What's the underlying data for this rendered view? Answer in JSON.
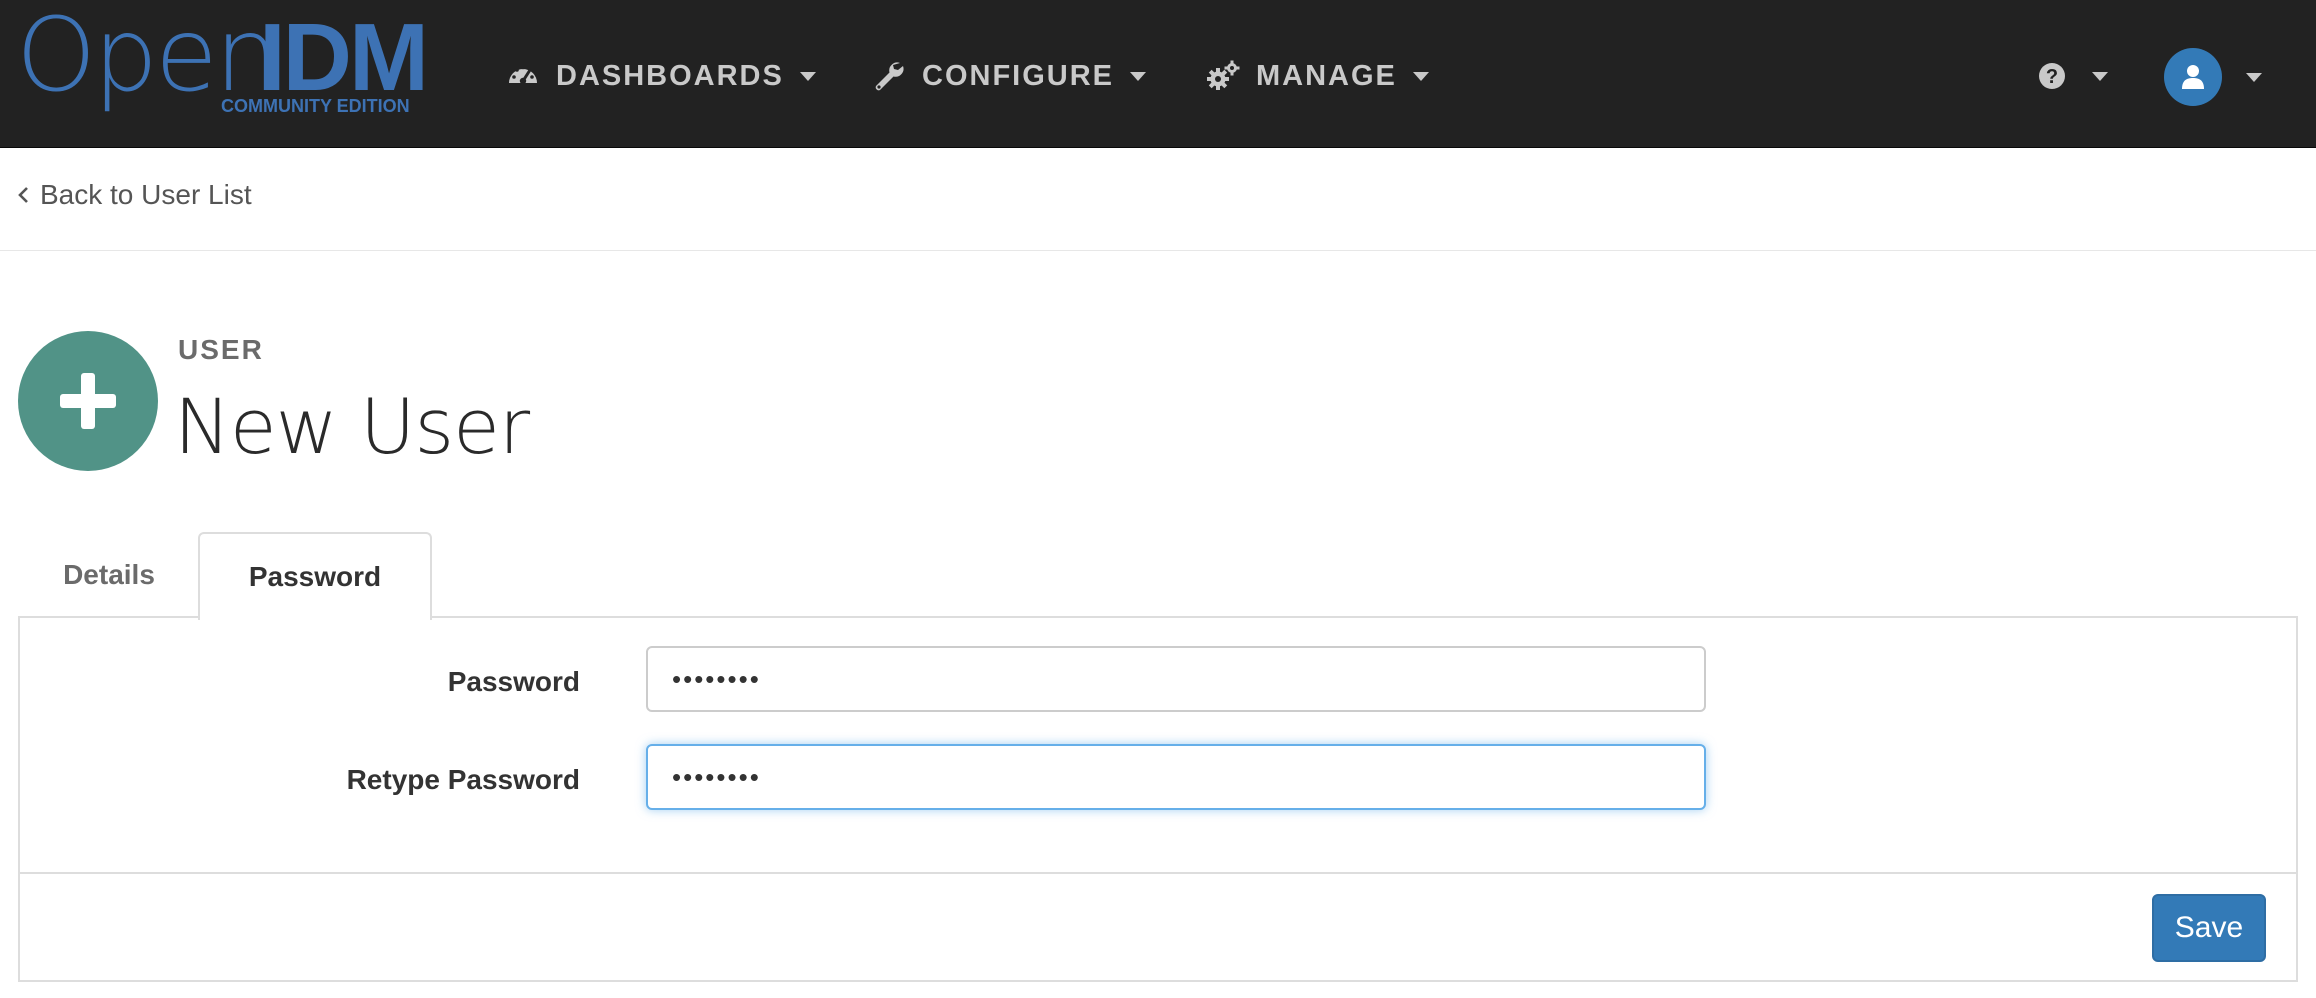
{
  "brand": {
    "logo_open": "Open",
    "logo_idm": "IDM",
    "logo_edition": "COMMUNITY EDITION"
  },
  "navbar": {
    "items": [
      {
        "label": "DASHBOARDS",
        "icon": "dashboard-icon"
      },
      {
        "label": "CONFIGURE",
        "icon": "wrench-icon"
      },
      {
        "label": "MANAGE",
        "icon": "gears-icon"
      }
    ],
    "help_icon": "question-circle-icon",
    "user_icon": "user-icon"
  },
  "back_link": {
    "label": "Back to User List"
  },
  "header": {
    "eyebrow": "USER",
    "title": "New User",
    "icon": "plus-icon"
  },
  "tabs": [
    {
      "label": "Details",
      "active": false
    },
    {
      "label": "Password",
      "active": true
    }
  ],
  "form": {
    "password_label": "Password",
    "password_value": "••••••••",
    "retype_label": "Retype Password",
    "retype_value": "••••••••"
  },
  "footer": {
    "save_label": "Save"
  },
  "colors": {
    "navbar_bg": "#222222",
    "brand_blue": "#3d72b4",
    "header_icon_bg": "#519387",
    "primary_button": "#337ab7",
    "focus_border": "#66afe9"
  }
}
